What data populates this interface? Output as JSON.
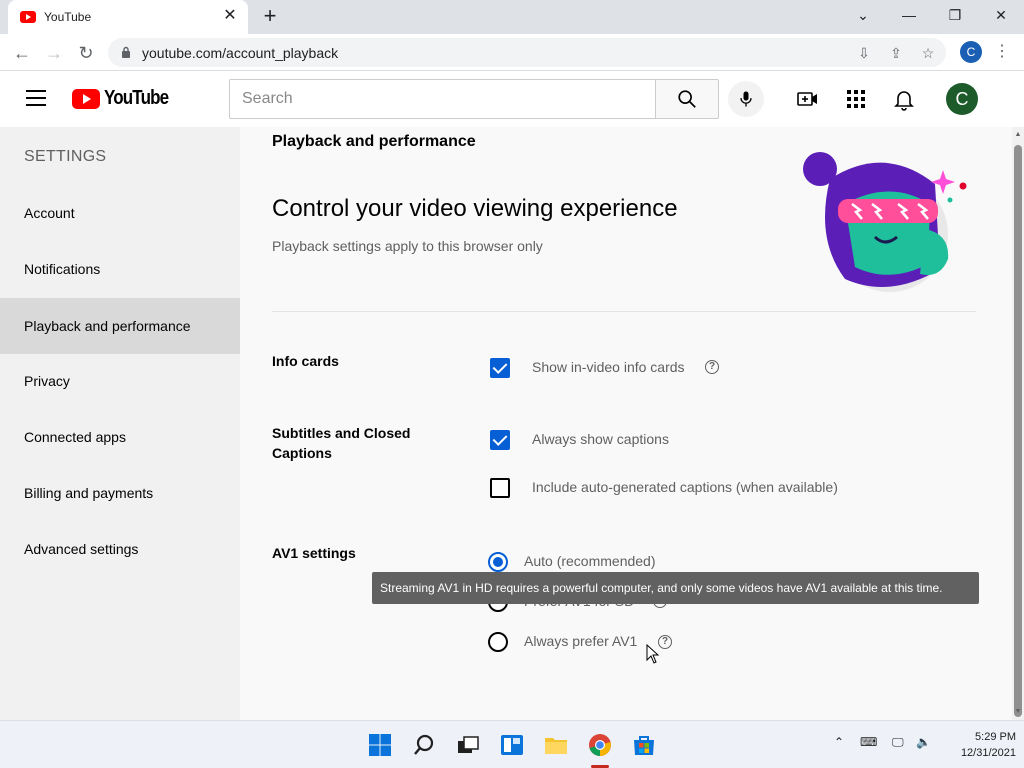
{
  "browser": {
    "tab_title": "YouTube",
    "url": "youtube.com/account_playback",
    "profile_initial": "C"
  },
  "masthead": {
    "logo_text": "YouTube",
    "search_placeholder": "Search",
    "avatar_initial": "C"
  },
  "sidebar": {
    "heading": "SETTINGS",
    "items": [
      {
        "label": "Account",
        "active": false
      },
      {
        "label": "Notifications",
        "active": false
      },
      {
        "label": "Playback and performance",
        "active": true
      },
      {
        "label": "Privacy",
        "active": false
      },
      {
        "label": "Connected apps",
        "active": false
      },
      {
        "label": "Billing and payments",
        "active": false
      },
      {
        "label": "Advanced settings",
        "active": false
      }
    ]
  },
  "main": {
    "heading": "Playback and performance",
    "title": "Control your video viewing experience",
    "subtitle": "Playback settings apply to this browser only",
    "sections": {
      "info_cards": {
        "label": "Info cards",
        "options": [
          {
            "label": "Show in-video info cards",
            "checked": true
          }
        ]
      },
      "captions": {
        "label": "Subtitles and Closed Captions",
        "options": [
          {
            "label": "Always show captions",
            "checked": true
          },
          {
            "label": "Include auto-generated captions (when available)",
            "checked": false
          }
        ]
      },
      "av1": {
        "label": "AV1 settings",
        "options": [
          {
            "label": "Auto (recommended)",
            "selected": true
          },
          {
            "label": "Prefer AV1 for SD",
            "selected": false
          },
          {
            "label": "Always prefer AV1",
            "selected": false
          }
        ]
      }
    },
    "tooltip": "Streaming AV1 in HD requires a powerful computer, and only some videos have AV1 available at this time."
  },
  "taskbar": {
    "time": "5:29 PM",
    "date": "12/31/2021"
  },
  "colors": {
    "accent": "#065fd4",
    "youtube_red": "#ff0000",
    "avatar": "#1e5b2a"
  }
}
